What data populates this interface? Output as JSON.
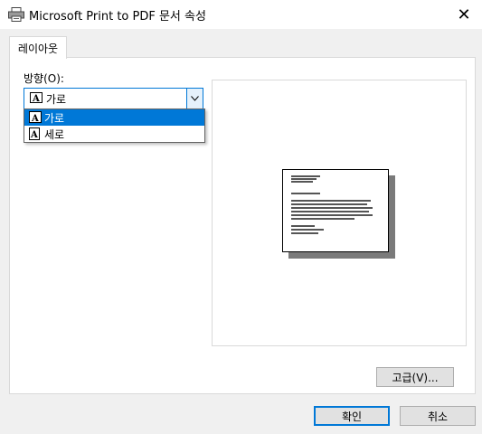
{
  "window": {
    "title": "Microsoft Print to PDF 문서 속성",
    "close_glyph": "✕"
  },
  "tabs": [
    {
      "label": "레이아웃",
      "selected": true
    }
  ],
  "layout": {
    "orientation_label": "방향(O):",
    "orientation_selected": "가로",
    "orientation_options": [
      "가로",
      "세로"
    ],
    "advanced_button": "고급(V)..."
  },
  "footer": {
    "ok_label": "확인",
    "cancel_label": "취소"
  },
  "colors": {
    "accent": "#0078d7",
    "dialog_bg": "#f0f0f0"
  }
}
